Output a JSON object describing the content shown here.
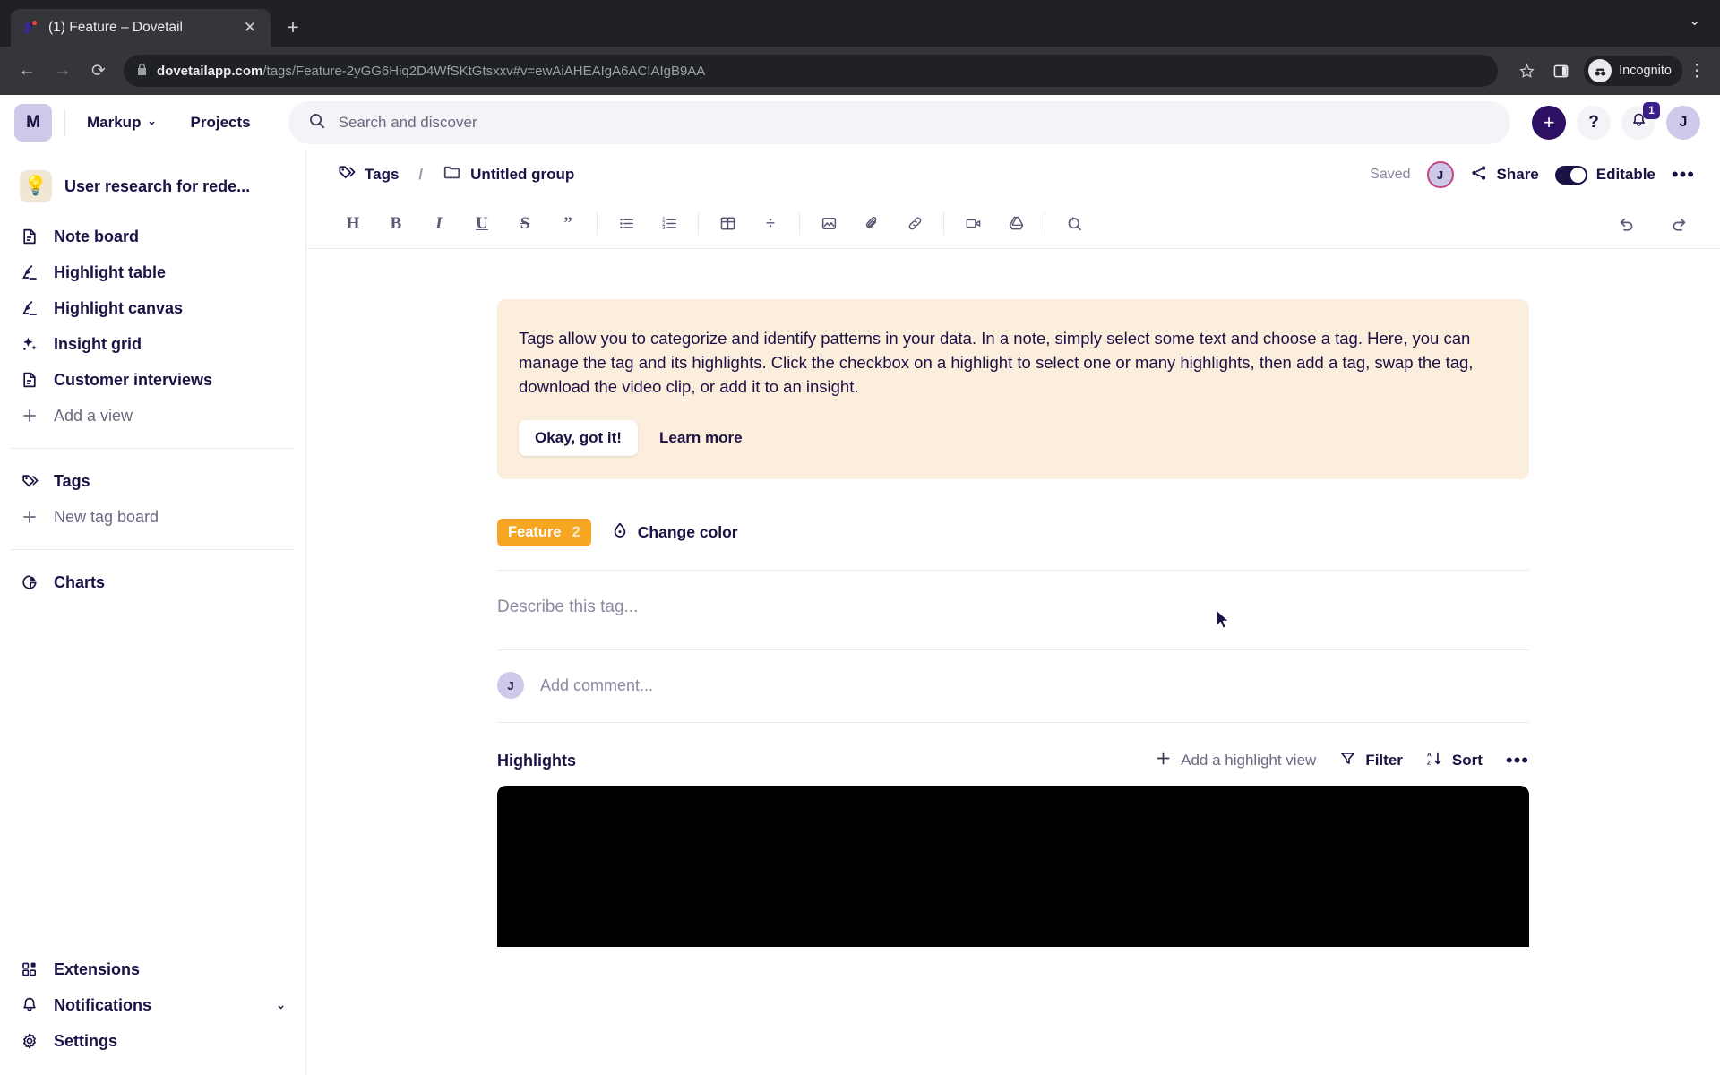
{
  "browser": {
    "tab_title": "(1) Feature – Dovetail",
    "tab_close_glyph": "✕",
    "new_tab_glyph": "+",
    "tablist_caret_glyph": "⌄",
    "back_glyph": "←",
    "forward_glyph": "→",
    "reload_glyph": "⟳",
    "lock_glyph": "🔒",
    "url_domain": "dovetailapp.com",
    "url_path": "/tags/Feature-2yGG6Hiq2D4WfSKtGtsxxv#v=ewAiAHEAIgA6ACIAIgB9AA",
    "profile_label": "Incognito",
    "menu_glyph": "⋮"
  },
  "header": {
    "workspace_initial": "M",
    "workspace_label": "Markup",
    "workspace_caret": "⌄",
    "projects_label": "Projects",
    "search_placeholder": "Search and discover",
    "create_glyph": "+",
    "help_glyph": "?",
    "notification_count": "1",
    "user_initial": "J"
  },
  "sidebar": {
    "project_name": "User research for rede...",
    "project_emoji": "💡",
    "views": [
      {
        "label": "Note board",
        "icon": "document-icon"
      },
      {
        "label": "Highlight table",
        "icon": "highlighter-icon"
      },
      {
        "label": "Highlight canvas",
        "icon": "highlighter-icon"
      },
      {
        "label": "Insight grid",
        "icon": "sparkle-icon"
      },
      {
        "label": "Customer interviews",
        "icon": "document-icon"
      }
    ],
    "add_view_label": "Add a view",
    "tags_label": "Tags",
    "new_tag_board_label": "New tag board",
    "charts_label": "Charts",
    "bottom": [
      {
        "label": "Extensions",
        "icon": "extensions-icon",
        "chevron": ""
      },
      {
        "label": "Notifications",
        "icon": "bell-icon",
        "chevron": "⌄"
      },
      {
        "label": "Settings",
        "icon": "gear-icon",
        "chevron": ""
      }
    ]
  },
  "doc_header": {
    "crumb_root": "Tags",
    "crumb_sep": "/",
    "crumb_group": "Untitled group",
    "saved_label": "Saved",
    "presence_initial": "J",
    "share_label": "Share",
    "editable_label": "Editable",
    "more_glyph": "•••"
  },
  "toolbar": {
    "items": [
      {
        "name": "heading-icon",
        "glyph": "H",
        "type": "text"
      },
      {
        "name": "bold-icon",
        "glyph": "B",
        "type": "text"
      },
      {
        "name": "italic-icon",
        "glyph": "I",
        "type": "text"
      },
      {
        "name": "underline-icon",
        "glyph": "U",
        "type": "text"
      },
      {
        "name": "strikethrough-icon",
        "glyph": "S",
        "type": "text"
      },
      {
        "name": "blockquote-icon",
        "glyph": "”",
        "type": "text"
      },
      {
        "name": "bullet-list-icon",
        "glyph": "",
        "type": "svg"
      },
      {
        "name": "numbered-list-icon",
        "glyph": "",
        "type": "svg"
      },
      {
        "name": "table-icon",
        "glyph": "",
        "type": "svg"
      },
      {
        "name": "divider-icon",
        "glyph": "÷",
        "type": "text"
      },
      {
        "name": "image-icon",
        "glyph": "",
        "type": "svg"
      },
      {
        "name": "attachment-icon",
        "glyph": "",
        "type": "svg"
      },
      {
        "name": "link-icon",
        "glyph": "",
        "type": "svg"
      },
      {
        "name": "video-icon",
        "glyph": "",
        "type": "svg"
      },
      {
        "name": "google-drive-icon",
        "glyph": "",
        "type": "svg"
      },
      {
        "name": "search-replace-icon",
        "glyph": "",
        "type": "svg"
      }
    ],
    "undo_glyph": "↺",
    "redo_glyph": "↻"
  },
  "banner": {
    "text": "Tags allow you to categorize and identify patterns in your data. In a note, simply select some text and choose a tag. Here, you can manage the tag and its highlights. Click the checkbox on a highlight to select one or many highlights, then add a tag, swap the tag, download the video clip, or add it to an insight.",
    "primary_label": "Okay, got it!",
    "secondary_label": "Learn more",
    "background_color": "#fbeedd"
  },
  "tag": {
    "name": "Feature",
    "count": "2",
    "color": "#f5a623",
    "change_color_label": "Change color"
  },
  "content": {
    "describe_placeholder": "Describe this tag...",
    "comment_avatar_initial": "J",
    "comment_placeholder": "Add comment..."
  },
  "highlights": {
    "title": "Highlights",
    "add_view_label": "Add a highlight view",
    "filter_label": "Filter",
    "sort_label": "Sort",
    "more_glyph": "•••",
    "add_glyph": "+"
  }
}
